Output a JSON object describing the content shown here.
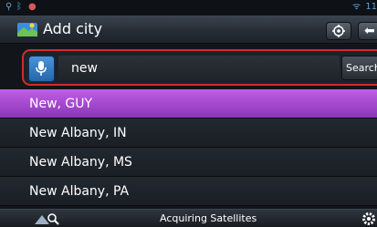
{
  "status_bar": {
    "left_icons": [
      "usb-icon",
      "bluetooth-icon",
      "notification-icon"
    ],
    "right_icons": [
      "wifi-icon"
    ],
    "time": "11"
  },
  "header": {
    "title": "Add city"
  },
  "search": {
    "query": "new",
    "button_label": "Search"
  },
  "results": [
    {
      "label": "New, GUY",
      "selected": true
    },
    {
      "label": "New Albany, IN",
      "selected": false
    },
    {
      "label": "New Albany, MS",
      "selected": false
    },
    {
      "label": "New Albany, PA",
      "selected": false
    }
  ],
  "footer": {
    "status": "Acquiring Satellites"
  },
  "colors": {
    "selection": "#a84ad6",
    "highlight_border": "#d42b2b",
    "mic_button": "#3a80c8"
  }
}
